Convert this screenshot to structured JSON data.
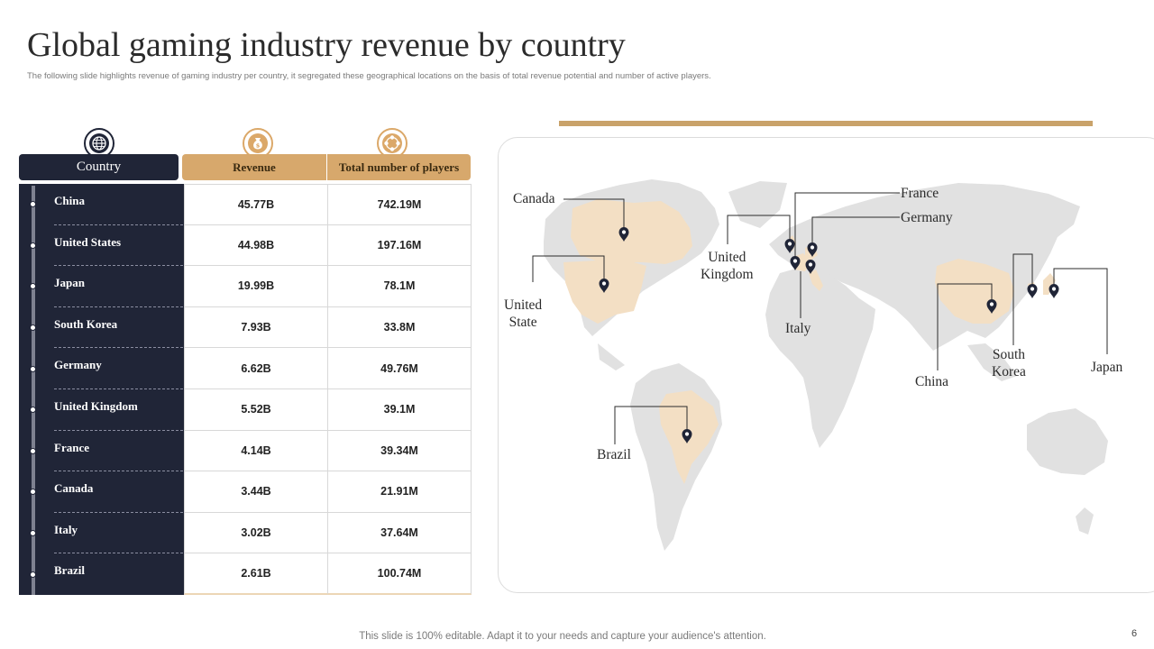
{
  "title": "Global gaming industry revenue by country",
  "subtitle": "The following slide highlights revenue of gaming industry per country, it segregated these geographical locations on the basis of total revenue potential and number of active players.",
  "table": {
    "headers": {
      "country": "Country",
      "revenue": "Revenue",
      "players": "Total number of players"
    },
    "header_icons": [
      "globe-icon",
      "money-bag-icon",
      "players-icon"
    ],
    "rows": [
      {
        "country": "China",
        "revenue": "45.77B",
        "players": "742.19M"
      },
      {
        "country": "United States",
        "revenue": "44.98B",
        "players": "197.16M"
      },
      {
        "country": "Japan",
        "revenue": "19.99B",
        "players": "78.1M"
      },
      {
        "country": "South Korea",
        "revenue": "7.93B",
        "players": "33.8M"
      },
      {
        "country": "Germany",
        "revenue": "6.62B",
        "players": "49.76M"
      },
      {
        "country": "United Kingdom",
        "revenue": "5.52B",
        "players": "39.1M"
      },
      {
        "country": "France",
        "revenue": "4.14B",
        "players": "39.34M"
      },
      {
        "country": "Canada",
        "revenue": "3.44B",
        "players": "21.91M"
      },
      {
        "country": "Italy",
        "revenue": "3.02B",
        "players": "37.64M"
      },
      {
        "country": "Brazil",
        "revenue": "2.61B",
        "players": "100.74M"
      }
    ]
  },
  "map": {
    "labels": {
      "canada": "Canada",
      "united_state": [
        "United",
        "State"
      ],
      "united_kingdom": [
        "United",
        "Kingdom"
      ],
      "france": "France",
      "germany": "Germany",
      "italy": "Italy",
      "china": "China",
      "south_korea": [
        "South",
        "Korea"
      ],
      "japan": "Japan",
      "brazil": "Brazil"
    },
    "marker_icon": "map-pin-icon"
  },
  "colors": {
    "dark_navy": "#202537",
    "gold": "#d7a86c",
    "highlight": "#f3dfc4",
    "land": "#e1e1e1"
  },
  "footer": "This slide is 100% editable. Adapt it to your needs and capture your audience's attention.",
  "page_number": "6"
}
